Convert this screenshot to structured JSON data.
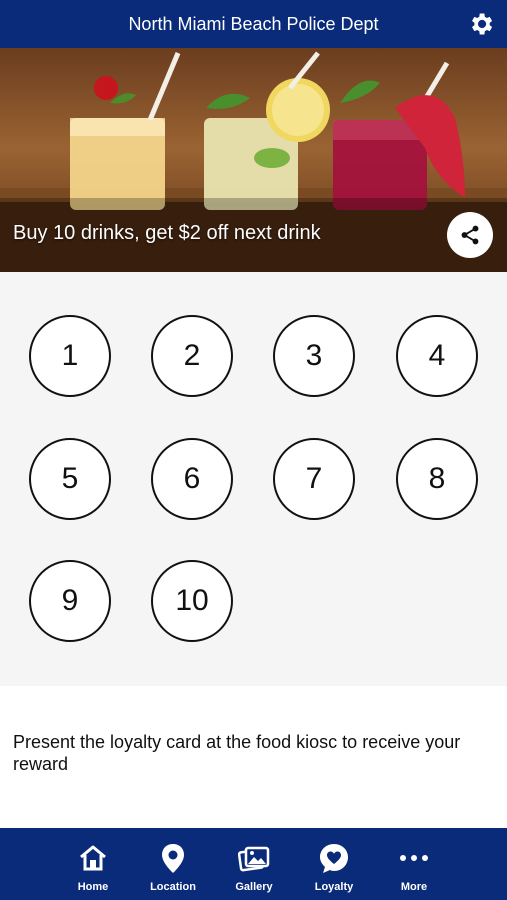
{
  "header": {
    "title": "North Miami Beach Police Dept",
    "settings_icon": "gear-icon"
  },
  "hero": {
    "caption": "Buy 10 drinks, get $2 off next drink",
    "share_icon": "share-icon"
  },
  "stamps": [
    {
      "label": "1"
    },
    {
      "label": "2"
    },
    {
      "label": "3"
    },
    {
      "label": "4"
    },
    {
      "label": "5"
    },
    {
      "label": "6"
    },
    {
      "label": "7"
    },
    {
      "label": "8"
    },
    {
      "label": "9"
    },
    {
      "label": "10"
    }
  ],
  "info": {
    "text": "Present the loyalty card at the food kiosc to receive your reward"
  },
  "tabbar": {
    "accent": "#0a2a7a",
    "items": [
      {
        "label": "Home",
        "icon": "home-icon"
      },
      {
        "label": "Location",
        "icon": "location-pin-icon"
      },
      {
        "label": "Gallery",
        "icon": "gallery-icon"
      },
      {
        "label": "Loyalty",
        "icon": "heart-bubble-icon"
      },
      {
        "label": "More",
        "icon": "more-dots-icon"
      }
    ]
  }
}
